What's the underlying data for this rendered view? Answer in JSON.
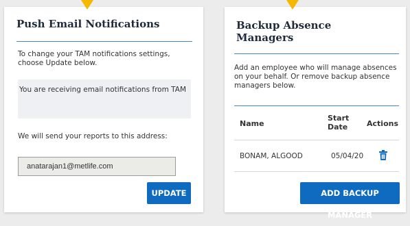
{
  "push_card": {
    "title": "Push Email Notifications",
    "description": "To change your TAM notifications settings, choose Update below.",
    "status_text": "You are receiving email notifications from TAM",
    "address_label": "We will send your reports to this address:",
    "email_value": "anatarajan1@metlife.com",
    "update_label": "UPDATE"
  },
  "backup_card": {
    "title_line1": "Backup Absence",
    "title_line2": "Managers",
    "description": "Add an employee who will manage absences on your behalf. Or remove backup absence managers below.",
    "columns": {
      "name": "Name",
      "start_line1": "Start",
      "start_line2": "Date",
      "actions": "Actions"
    },
    "rows": [
      {
        "name": "BONAM, ALGOOD",
        "start_date": "05/04/20"
      }
    ],
    "add_label": "ADD BACKUP MANAGER"
  },
  "colors": {
    "accent": "#0f6bbf",
    "rule": "#3f86c6",
    "notch": "#f5b800"
  },
  "icons": {
    "delete": "trash-icon"
  }
}
